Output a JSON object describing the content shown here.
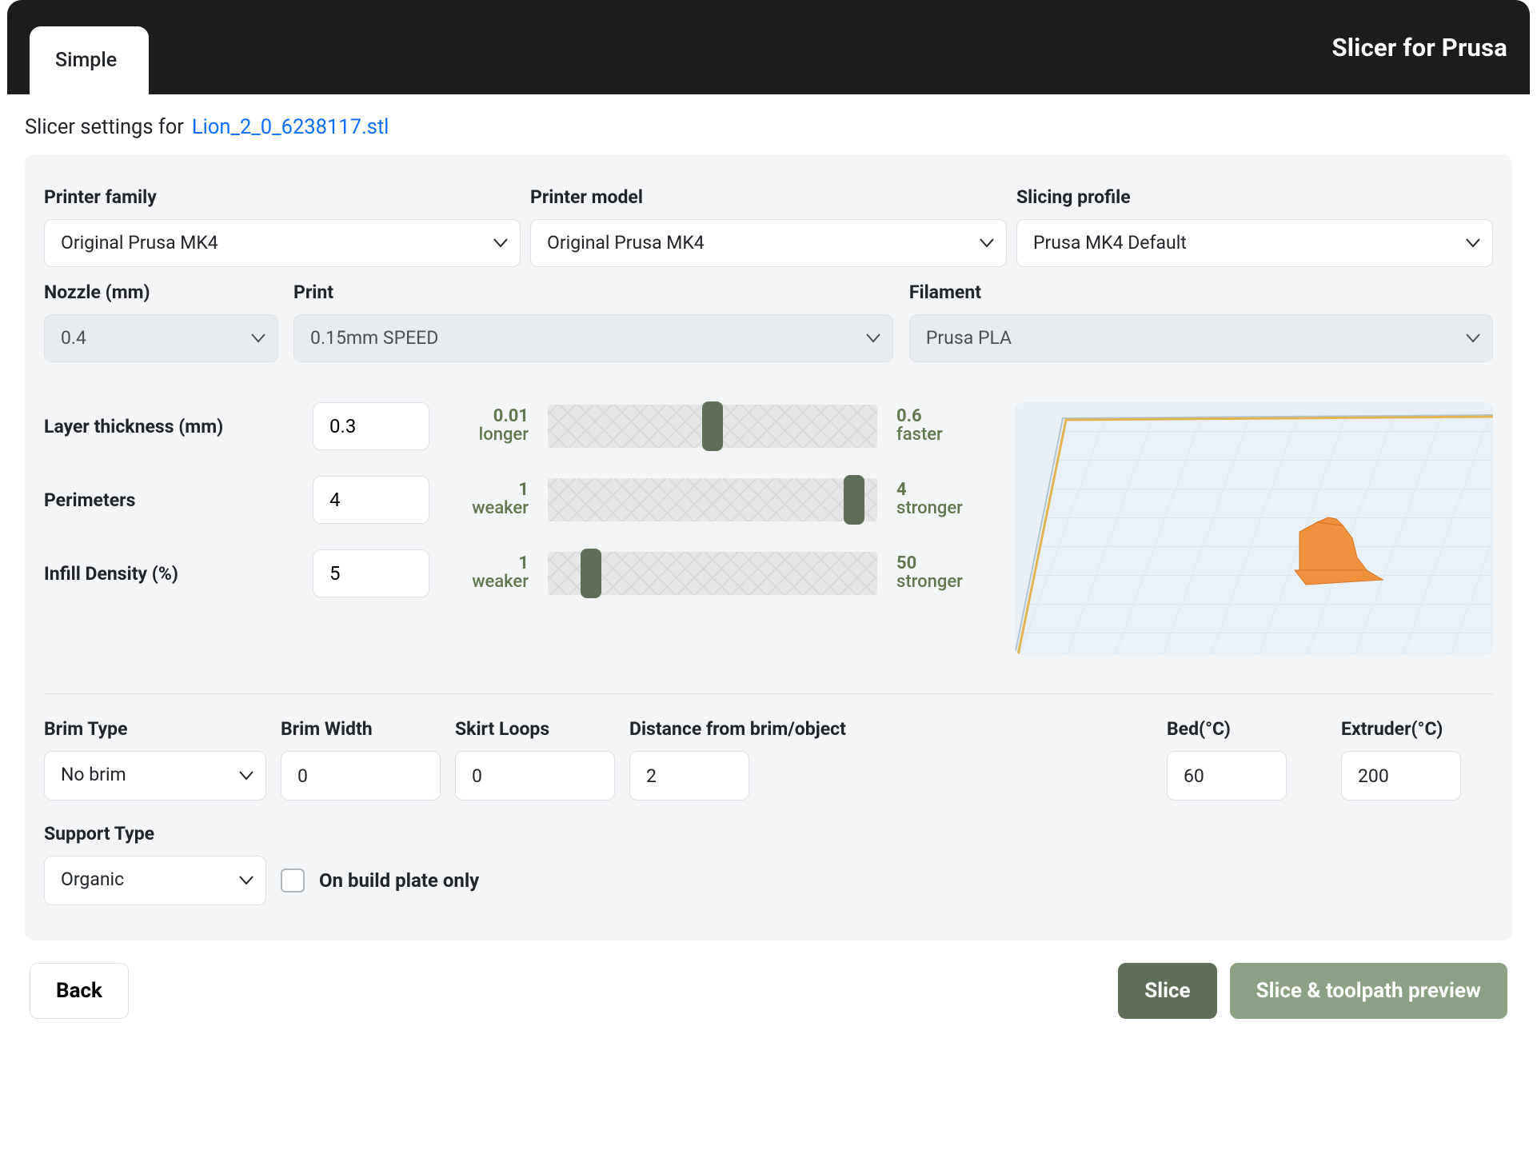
{
  "app_title": "Slicer for Prusa",
  "tabs": {
    "simple": "Simple"
  },
  "subheader": {
    "prefix": "Slicer settings for",
    "filename": "Lion_2_0_6238117.stl"
  },
  "settings_row1": {
    "printer_family": {
      "label": "Printer family",
      "value": "Original Prusa MK4"
    },
    "printer_model": {
      "label": "Printer model",
      "value": "Original Prusa MK4"
    },
    "slicing_profile": {
      "label": "Slicing profile",
      "value": "Prusa MK4 Default"
    }
  },
  "settings_row2": {
    "nozzle": {
      "label": "Nozzle (mm)",
      "value": "0.4"
    },
    "print": {
      "label": "Print",
      "value": "0.15mm SPEED"
    },
    "filament": {
      "label": "Filament",
      "value": "Prusa PLA"
    }
  },
  "sliders": {
    "layer": {
      "label": "Layer thickness (mm)",
      "value": "0.3",
      "min_num": "0.01",
      "min_word": "longer",
      "max_num": "0.6",
      "max_word": "faster",
      "thumb_pct": 50
    },
    "perimeters": {
      "label": "Perimeters",
      "value": "4",
      "min_num": "1",
      "min_word": "weaker",
      "max_num": "4",
      "max_word": "stronger",
      "thumb_pct": 93
    },
    "infill": {
      "label": "Infill Density (%)",
      "value": "5",
      "min_num": "1",
      "min_word": "weaker",
      "max_num": "50",
      "max_word": "stronger",
      "thumb_pct": 13
    }
  },
  "bottom": {
    "brim_type": {
      "label": "Brim Type",
      "value": "No brim"
    },
    "brim_width": {
      "label": "Brim Width",
      "value": "0"
    },
    "skirt_loops": {
      "label": "Skirt Loops",
      "value": "0"
    },
    "distance": {
      "label": "Distance from brim/object",
      "value": "2"
    },
    "bed_temp": {
      "label": "Bed(°C)",
      "value": "60"
    },
    "extruder_temp": {
      "label": "Extruder(°C)",
      "value": "200"
    },
    "support_type": {
      "label": "Support Type",
      "value": "Organic"
    },
    "build_plate_only": "On build plate only"
  },
  "footer": {
    "back": "Back",
    "slice": "Slice",
    "slice_preview": "Slice & toolpath preview"
  }
}
